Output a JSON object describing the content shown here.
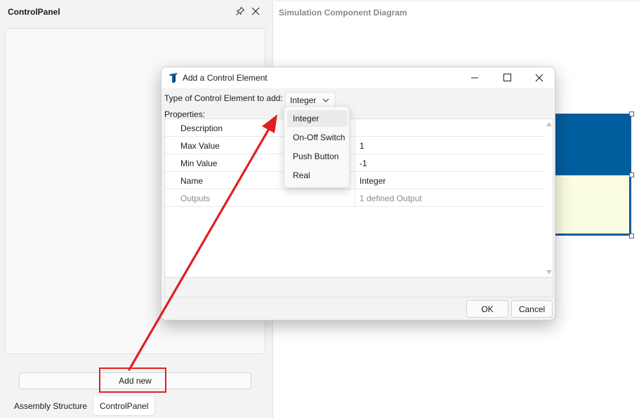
{
  "left_panel": {
    "title": "ControlPanel",
    "add_button_label": "Add new",
    "tabs": [
      {
        "label": "Assembly Structure"
      },
      {
        "label": "ControlPanel"
      }
    ]
  },
  "right_panel": {
    "title": "Simulation Component Diagram"
  },
  "dialog": {
    "title": "Add a Control Element",
    "type_label": "Type of Control Element to add:",
    "type_value": "Integer",
    "properties_label": "Properties:",
    "properties": [
      {
        "name": "Description",
        "value": ""
      },
      {
        "name": "Max Value",
        "value": "1"
      },
      {
        "name": "Min Value",
        "value": "-1"
      },
      {
        "name": "Name",
        "value": "Integer"
      },
      {
        "name": "Outputs",
        "value": "1 defined Output"
      }
    ],
    "ok_label": "OK",
    "cancel_label": "Cancel"
  },
  "dropdown": {
    "options": [
      "Integer",
      "On-Off Switch",
      "Push Button",
      "Real"
    ],
    "selected": "Integer"
  },
  "colors": {
    "accent_blue": "#005e9e",
    "annotation_red": "#e02020",
    "diagram_fill": "#fbfde3"
  }
}
